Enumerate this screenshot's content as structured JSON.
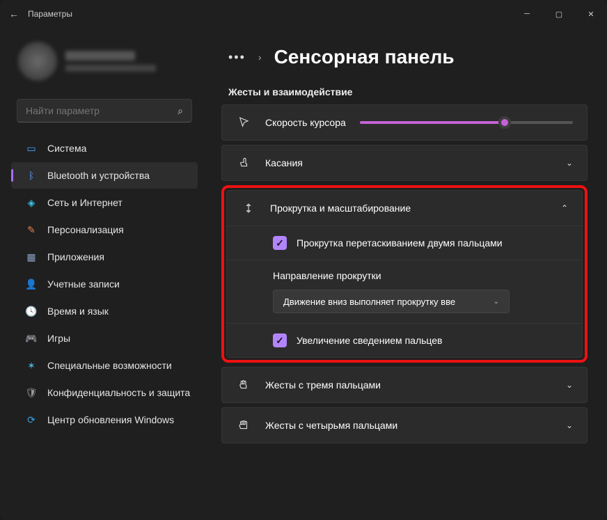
{
  "window": {
    "title": "Параметры"
  },
  "search": {
    "placeholder": "Найти параметр"
  },
  "nav": [
    {
      "label": "Система"
    },
    {
      "label": "Bluetooth и устройства"
    },
    {
      "label": "Сеть и Интернет"
    },
    {
      "label": "Персонализация"
    },
    {
      "label": "Приложения"
    },
    {
      "label": "Учетные записи"
    },
    {
      "label": "Время и язык"
    },
    {
      "label": "Игры"
    },
    {
      "label": "Специальные возможности"
    },
    {
      "label": "Конфиденциальность и защита"
    },
    {
      "label": "Центр обновления Windows"
    }
  ],
  "breadcrumb": {
    "sep": "›"
  },
  "pageTitle": "Сенсорная панель",
  "sectionLabel": "Жесты и взаимодействие",
  "cursor": {
    "label": "Скорость курсора"
  },
  "taps": {
    "label": "Касания"
  },
  "scroll": {
    "label": "Прокрутка и масштабирование",
    "opt1": "Прокрутка перетаскиванием двумя пальцами",
    "dirLabel": "Направление прокрутки",
    "dirValue": "Движение вниз выполняет прокрутку вве",
    "opt2": "Увеличение сведением пальцев"
  },
  "g3": {
    "label": "Жесты с тремя пальцами"
  },
  "g4": {
    "label": "Жесты с четырьмя пальцами"
  }
}
